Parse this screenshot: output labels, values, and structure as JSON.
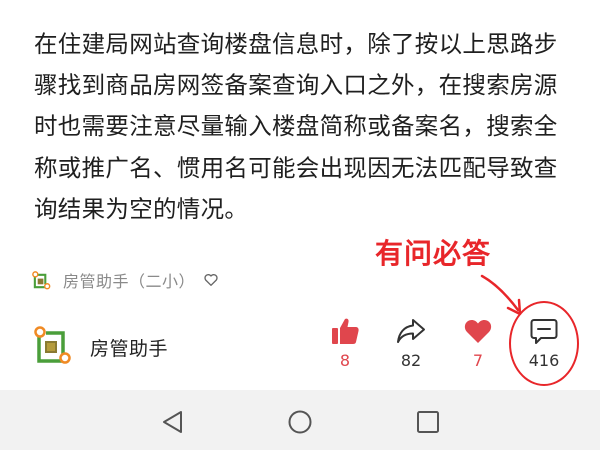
{
  "article": {
    "text": "在住建局网站查询楼盘信息时，除了按以上思路步骤找到商品房网签备案查询入口之外，在搜索房源时也需要注意尽量输入楼盘简称或备案名，搜索全称或推广名、惯用名可能会出现因无法匹配导致查询结果为空的情况。"
  },
  "annotation": {
    "label": "有问必答",
    "color": "#e8262a"
  },
  "source": {
    "label": "房管助手（二小）",
    "logo_icon": "house-manager-logo-icon",
    "follow_icon": "heart-outline-icon"
  },
  "author": {
    "name": "房管助手",
    "logo_icon": "house-manager-logo-icon"
  },
  "actions": {
    "like": {
      "icon": "thumbs-up-icon",
      "count": "8",
      "color": "#e0464d"
    },
    "share": {
      "icon": "share-arrow-icon",
      "count": "82",
      "color": "#333333"
    },
    "favorite": {
      "icon": "heart-filled-icon",
      "count": "7",
      "color": "#e0464d"
    },
    "comment": {
      "icon": "comment-bubble-icon",
      "count": "416",
      "color": "#333333"
    }
  },
  "navbar": {
    "back_icon": "triangle-back-icon",
    "home_icon": "circle-home-icon",
    "recents_icon": "square-recents-icon"
  }
}
